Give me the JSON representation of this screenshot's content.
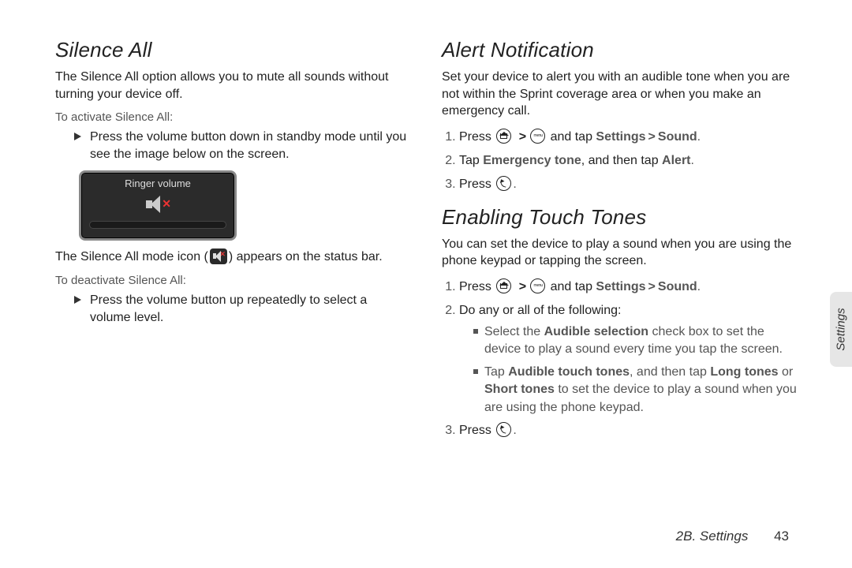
{
  "left": {
    "h_silence": "Silence All",
    "p_silence_intro": "The Silence All option allows you to mute all sounds without turning your device off.",
    "sub_activate": "To activate Silence All:",
    "li_activate": "Press the volume button down in standby mode until you see the image below on the screen.",
    "ringer_label": "Ringer volume",
    "p_icon_1": "The Silence All mode icon (",
    "p_icon_2": ") appears on the status bar.",
    "sub_deactivate": "To deactivate Silence All:",
    "li_deactivate": "Press the volume button up repeatedly to select a volume level."
  },
  "right": {
    "h_alert": "Alert Notification",
    "p_alert_intro": "Set your device to alert you with an audible tone when you are not within the Sprint coverage area or when you make an emergency call.",
    "alert_step1_a": "Press ",
    "alert_step1_b": " and tap ",
    "alert_step1_bold1": "Settings",
    "alert_step1_bold2": "Sound",
    "alert_step1_dot": ".",
    "alert_step2_a": "Tap ",
    "alert_step2_b1": "Emergency tone",
    "alert_step2_c": ", and then tap ",
    "alert_step2_b2": "Alert",
    "alert_step3_a": "Press ",
    "alert_step3_dot": ".",
    "h_touch": "Enabling Touch Tones",
    "p_touch_intro": "You can set the device to play a sound when you are using the phone keypad or tapping the screen.",
    "touch_step1_a": "Press ",
    "touch_step1_b": " and tap ",
    "touch_step1_bold1": "Settings",
    "touch_step1_bold2": "Sound",
    "touch_step2": "Do any or all of the following:",
    "touch_sq1_a": "Select the ",
    "touch_sq1_b1": "Audible selection",
    "touch_sq1_c": " check box to set the device to play a sound every time you tap the screen.",
    "touch_sq2_a": "Tap ",
    "touch_sq2_b1": "Audible touch tones",
    "touch_sq2_c": ", and then tap ",
    "touch_sq2_b2": "Long tones",
    "touch_sq2_d": " or ",
    "touch_sq2_b3": "Short tones",
    "touch_sq2_e": " to set the device to play a sound when you are using the phone keypad.",
    "touch_step3_a": "Press ",
    "touch_step3_dot": "."
  },
  "side_tab": "Settings",
  "footer_section": "2B. Settings",
  "footer_page": "43",
  "gt": ">"
}
